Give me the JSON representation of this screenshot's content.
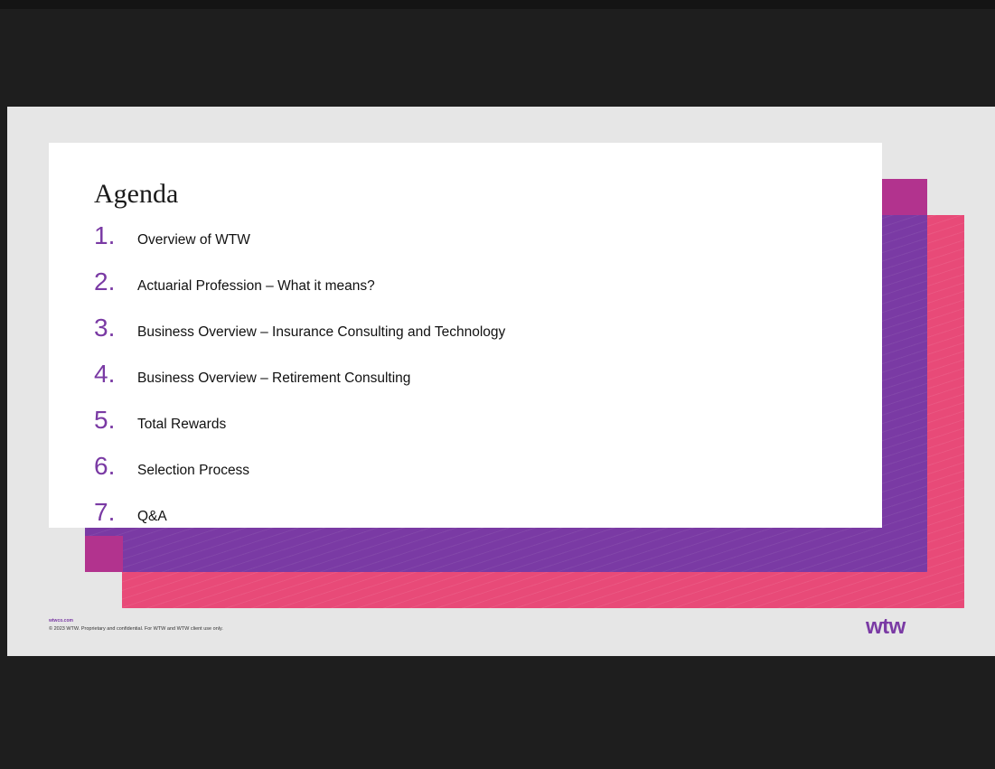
{
  "slide": {
    "title": "Agenda",
    "items": [
      {
        "number": "1.",
        "label": "Overview of WTW"
      },
      {
        "number": "2.",
        "label": "Actuarial Profession – What it means?"
      },
      {
        "number": "3.",
        "label": "Business Overview – Insurance Consulting and Technology"
      },
      {
        "number": "4.",
        "label": "Business Overview – Retirement Consulting"
      },
      {
        "number": "5.",
        "label": "Total Rewards"
      },
      {
        "number": "6.",
        "label": "Selection Process"
      },
      {
        "number": "7.",
        "label": "Q&A"
      }
    ],
    "footer_url": "wtwco.com",
    "footer_copyright": "© 2023 WTW. Proprietary and confidential. For WTW and WTW client use only.",
    "logo": "wtw"
  },
  "colors": {
    "accent_purple": "#7a3aa4",
    "accent_pink": "#e84a78",
    "overlap_magenta": "#b2338e"
  }
}
